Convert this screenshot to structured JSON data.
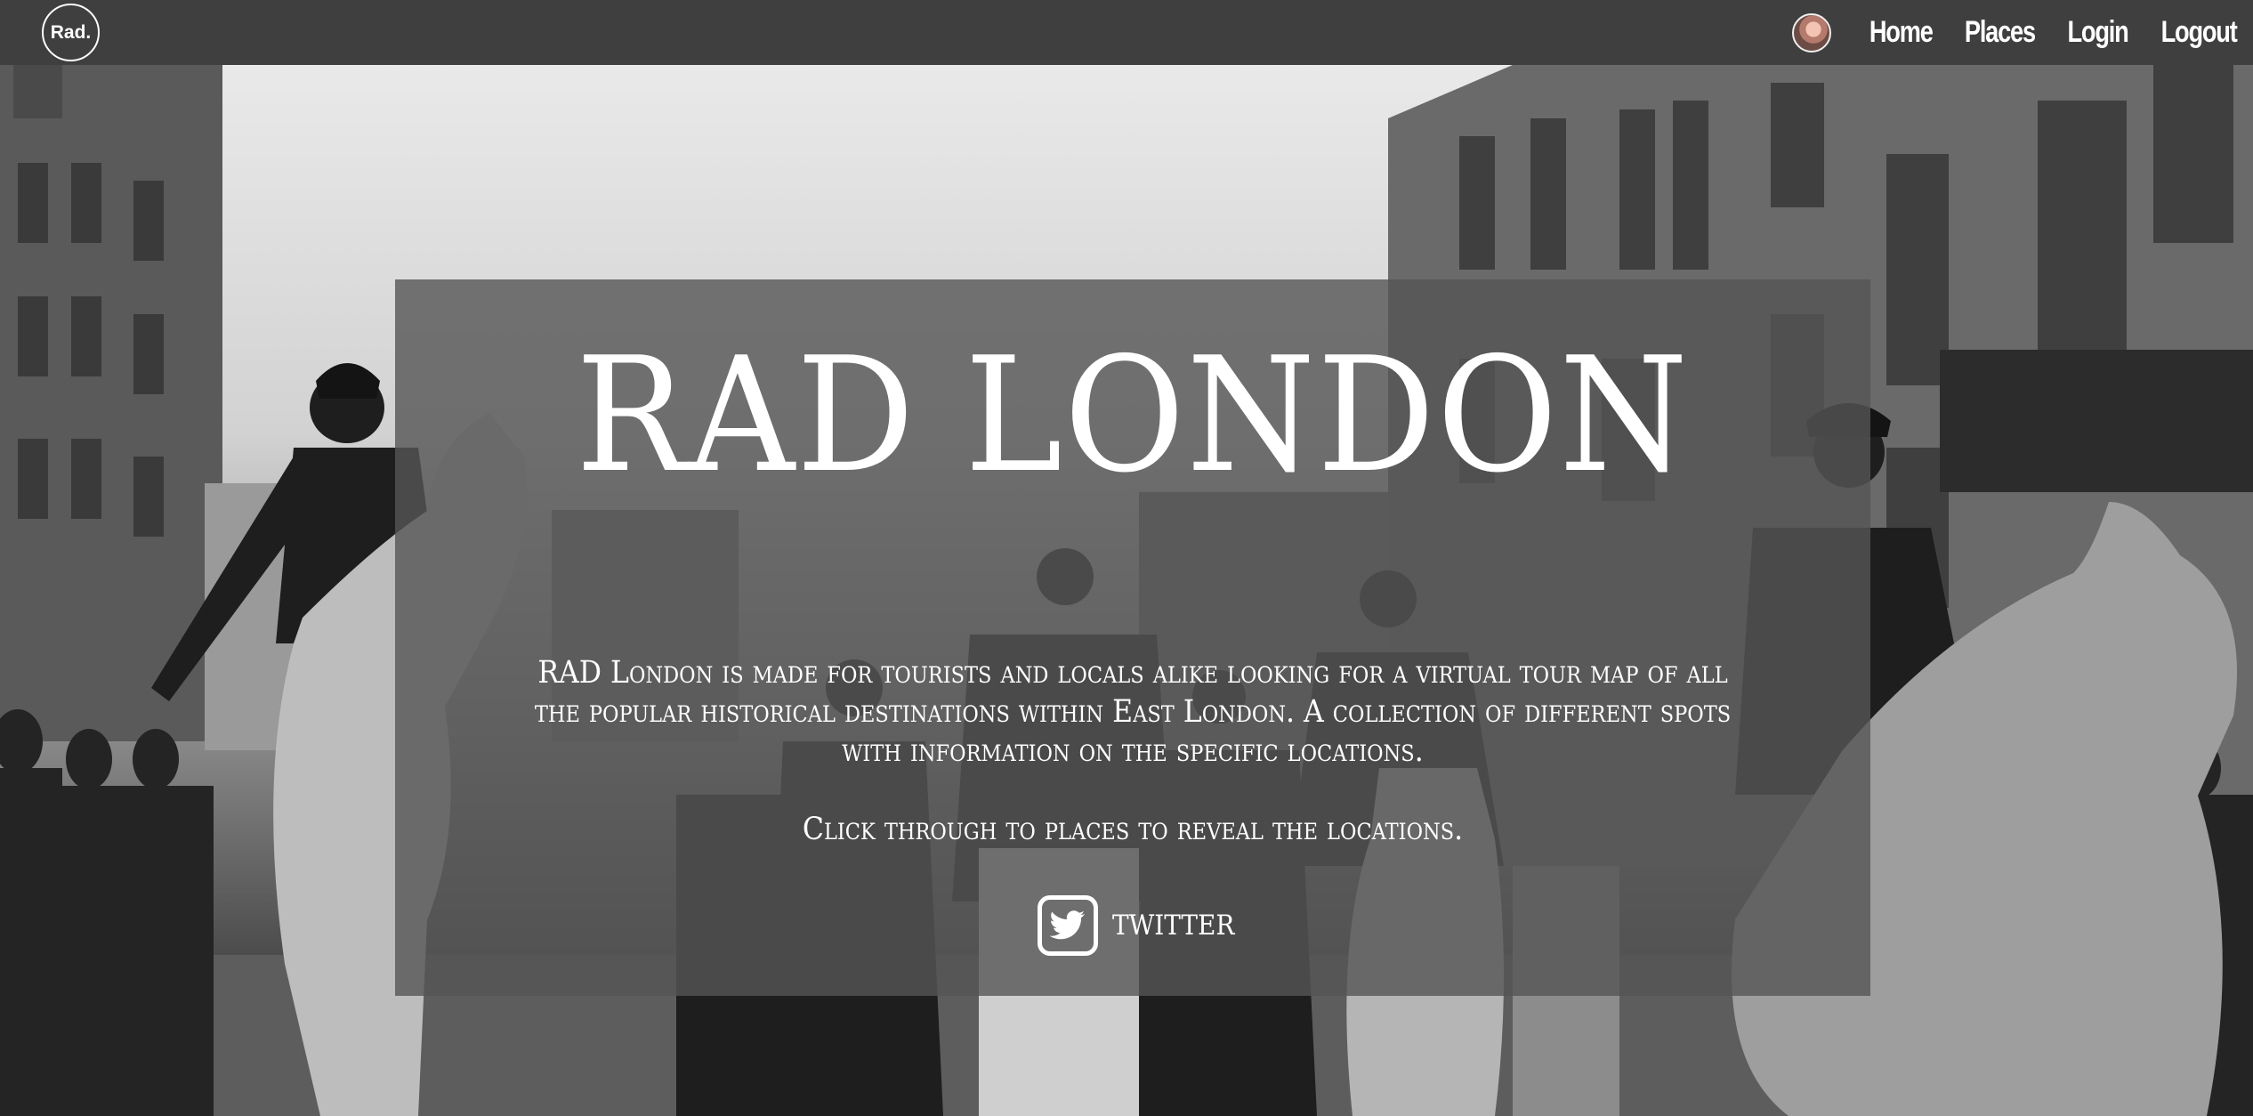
{
  "navbar": {
    "brand": "Rad.",
    "links": [
      "Home",
      "Places",
      "Login",
      "Logout"
    ],
    "avatar_icon": "user-avatar"
  },
  "hero": {
    "title": "RAD LONDON",
    "description": "RAD London is made for tourists and locals alike looking for a virtual tour map of all the popular historical destinations within East London. A collection of different spots with information on the specific locations.",
    "cta": "Click through to places to reveal the locations.",
    "twitter_label": "TWITTER",
    "twitter_icon": "twitter-bird-icon"
  },
  "colors": {
    "navbar_bg": "#3f3f3f",
    "panel_bg": "rgba(85,85,85,0.80)",
    "text": "#ffffff"
  }
}
